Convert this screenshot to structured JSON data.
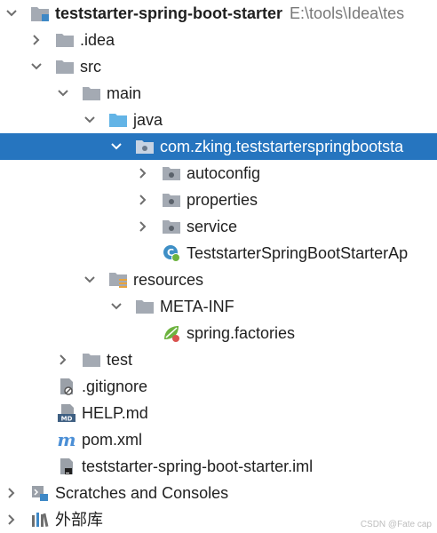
{
  "tree": {
    "project_name": "teststarter-spring-boot-starter",
    "project_path": "E:\\tools\\Idea\\tes",
    "items": [
      {
        "label": ".idea",
        "icon": "folder-icon"
      },
      {
        "label": "src",
        "icon": "folder-icon"
      },
      {
        "label": "main",
        "icon": "folder-icon"
      },
      {
        "label": "java",
        "icon": "source-folder-icon"
      },
      {
        "label": "com.zking.teststarterspringbootsta",
        "icon": "package-icon"
      },
      {
        "label": "autoconfig",
        "icon": "package-icon"
      },
      {
        "label": "properties",
        "icon": "package-icon"
      },
      {
        "label": "service",
        "icon": "package-icon"
      },
      {
        "label": "TeststarterSpringBootStarterAp",
        "icon": "spring-class-icon"
      },
      {
        "label": "resources",
        "icon": "resources-folder-icon"
      },
      {
        "label": "META-INF",
        "icon": "folder-icon"
      },
      {
        "label": "spring.factories",
        "icon": "spring-factories-icon"
      },
      {
        "label": "test",
        "icon": "folder-icon"
      },
      {
        "label": ".gitignore",
        "icon": "ignored-file-icon"
      },
      {
        "label": "HELP.md",
        "icon": "markdown-icon"
      },
      {
        "label": "pom.xml",
        "icon": "maven-icon"
      },
      {
        "label": "teststarter-spring-boot-starter.iml",
        "icon": "iml-file-icon"
      },
      {
        "label": "Scratches and Consoles",
        "icon": "scratches-icon"
      },
      {
        "label": "外部库",
        "icon": "external-libraries-icon"
      }
    ]
  },
  "watermark": "CSDN @Fate cap",
  "colors": {
    "selection": "#2675bf",
    "folder": "#a4aab3",
    "source_folder": "#63b4e6",
    "spring": "#6db33f",
    "arrow": "#6e6e6e"
  }
}
